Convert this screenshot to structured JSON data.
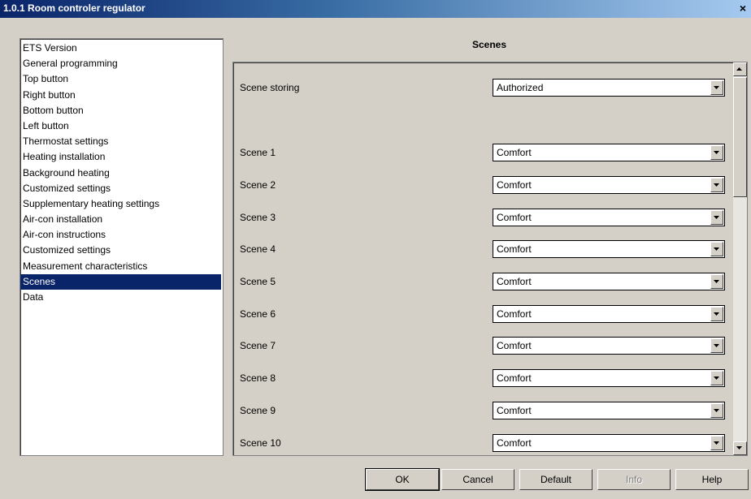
{
  "window": {
    "title": "1.0.1 Room controler regulator",
    "close_glyph": "×"
  },
  "tree": {
    "items": [
      "ETS Version",
      "General programming",
      "Top button",
      "Right button",
      "Bottom button",
      "Left button",
      "Thermostat settings",
      "Heating installation",
      "Background heating",
      "Customized settings",
      "Supplementary heating settings",
      "Air-con installation",
      "Air-con instructions",
      "Customized settings",
      "Measurement characteristics",
      "Scenes",
      "Data"
    ],
    "selected": "Scenes"
  },
  "section": {
    "title": "Scenes"
  },
  "params": {
    "storing": {
      "label": "Scene storing",
      "value": "Authorized"
    },
    "scenes": [
      {
        "label": "Scene 1",
        "value": "Comfort"
      },
      {
        "label": "Scene 2",
        "value": "Comfort"
      },
      {
        "label": "Scene 3",
        "value": "Comfort"
      },
      {
        "label": "Scene 4",
        "value": "Comfort"
      },
      {
        "label": "Scene 5",
        "value": "Comfort"
      },
      {
        "label": "Scene 6",
        "value": "Comfort"
      },
      {
        "label": "Scene 7",
        "value": "Comfort"
      },
      {
        "label": "Scene 8",
        "value": "Comfort"
      },
      {
        "label": "Scene 9",
        "value": "Comfort"
      },
      {
        "label": "Scene 10",
        "value": "Comfort"
      }
    ]
  },
  "buttons": {
    "ok": "OK",
    "cancel": "Cancel",
    "default": "Default",
    "info": "Info",
    "help": "Help"
  },
  "colors": {
    "selection": "#0a246a",
    "face": "#d4d0c8"
  }
}
